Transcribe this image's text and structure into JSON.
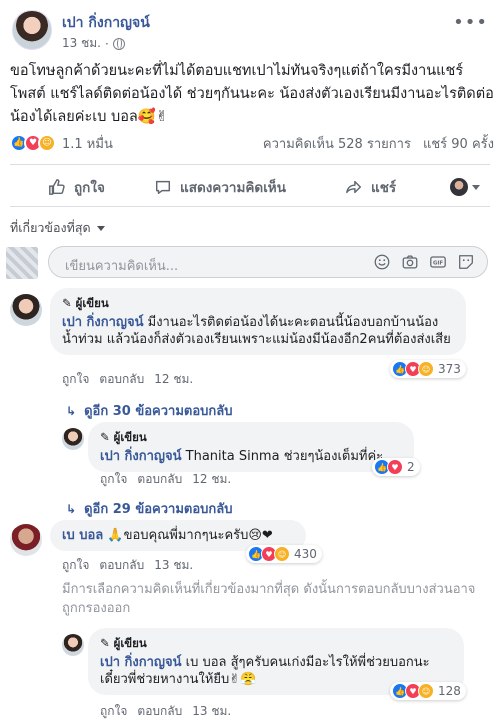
{
  "post": {
    "author": "เปา กิ่งกาญจน์",
    "time": "13 ชม.",
    "text": "ขอโทษลูกค้าด้วยนะคะที่ไม่ได้ตอบแชทเปาไม่ทันจริงๆแต่ถ้าใครมีงานแชร์โพสต์ แชร์ไลด์ติดต่อน้องได้ ช่วยๆกันนะคะ น้องส่งตัวเองเรียนมีงานอะไรติดต่อน้องได้เลยค่ะเบ บอล🥰✌",
    "reactions_count": "1.1 หมื่น",
    "comments_count": "ความคิดเห็น 528 รายการ",
    "shares_count": "แชร์ 90 ครั้ง"
  },
  "actions": {
    "like": "ถูกใจ",
    "comment": "แสดงความคิดเห็น",
    "share": "แชร์"
  },
  "filter_label": "ที่เกี่ยวข้องที่สุด",
  "composer_placeholder": "เขียนความคิดเห็น...",
  "comments": {
    "c1": {
      "badge": "ผู้เขียน",
      "name": "เปา กิ่งกาญจน์",
      "text": "มีงานอะไรติดต่อน้องได้นะคะตอนนี้น้องบอกบ้านน้องน้ำท่วม แล้วน้องก็ส่งตัวเองเรียนเพราะแม่น้องมีน้องอีก2คนที่ต้องส่งเสีย",
      "like": "ถูกใจ",
      "reply": "ตอบกลับ",
      "time": "12 ชม.",
      "reactions": "373"
    },
    "more1": "ดูอีก 30 ข้อความตอบกลับ",
    "r1": {
      "badge": "ผู้เขียน",
      "name": "เปา กิ่งกาญจน์",
      "text": "Thanita Sinma ช่วยๆน้องเต็มที่ค่ะ",
      "like": "ถูกใจ",
      "reply": "ตอบกลับ",
      "time": "12 ชม.",
      "reactions": "2"
    },
    "more2": "ดูอีก 29 ข้อความตอบกลับ",
    "c2": {
      "name": "เบ บอล",
      "text": "🙏ขอบคุณพี่มากๆนะครับ😢❤",
      "like": "ถูกใจ",
      "reply": "ตอบกลับ",
      "time": "13 ชม.",
      "reactions": "430"
    },
    "notice": "มีการเลือกความคิดเห็นที่เกี่ยวข้องมากที่สุด ดังนั้นการตอบกลับบางส่วนอาจถูกกรองออก",
    "r2": {
      "badge": "ผู้เขียน",
      "name": "เปา กิ่งกาญจน์",
      "text": "เบ บอล สู้ๆครับคนเก่งมีอะไรให้พี่ช่วยบอกนะเดี๋ยวพี่ช่วยหางานให้ยืบ✌😤",
      "like": "ถูกใจ",
      "reply": "ตอบกลับ",
      "time": "13 ชม.",
      "reactions": "128"
    }
  },
  "colors": {
    "link": "#385898",
    "like_blue": "#1877f2",
    "love_red": "#f33e58",
    "care_yellow": "#f7b125"
  }
}
